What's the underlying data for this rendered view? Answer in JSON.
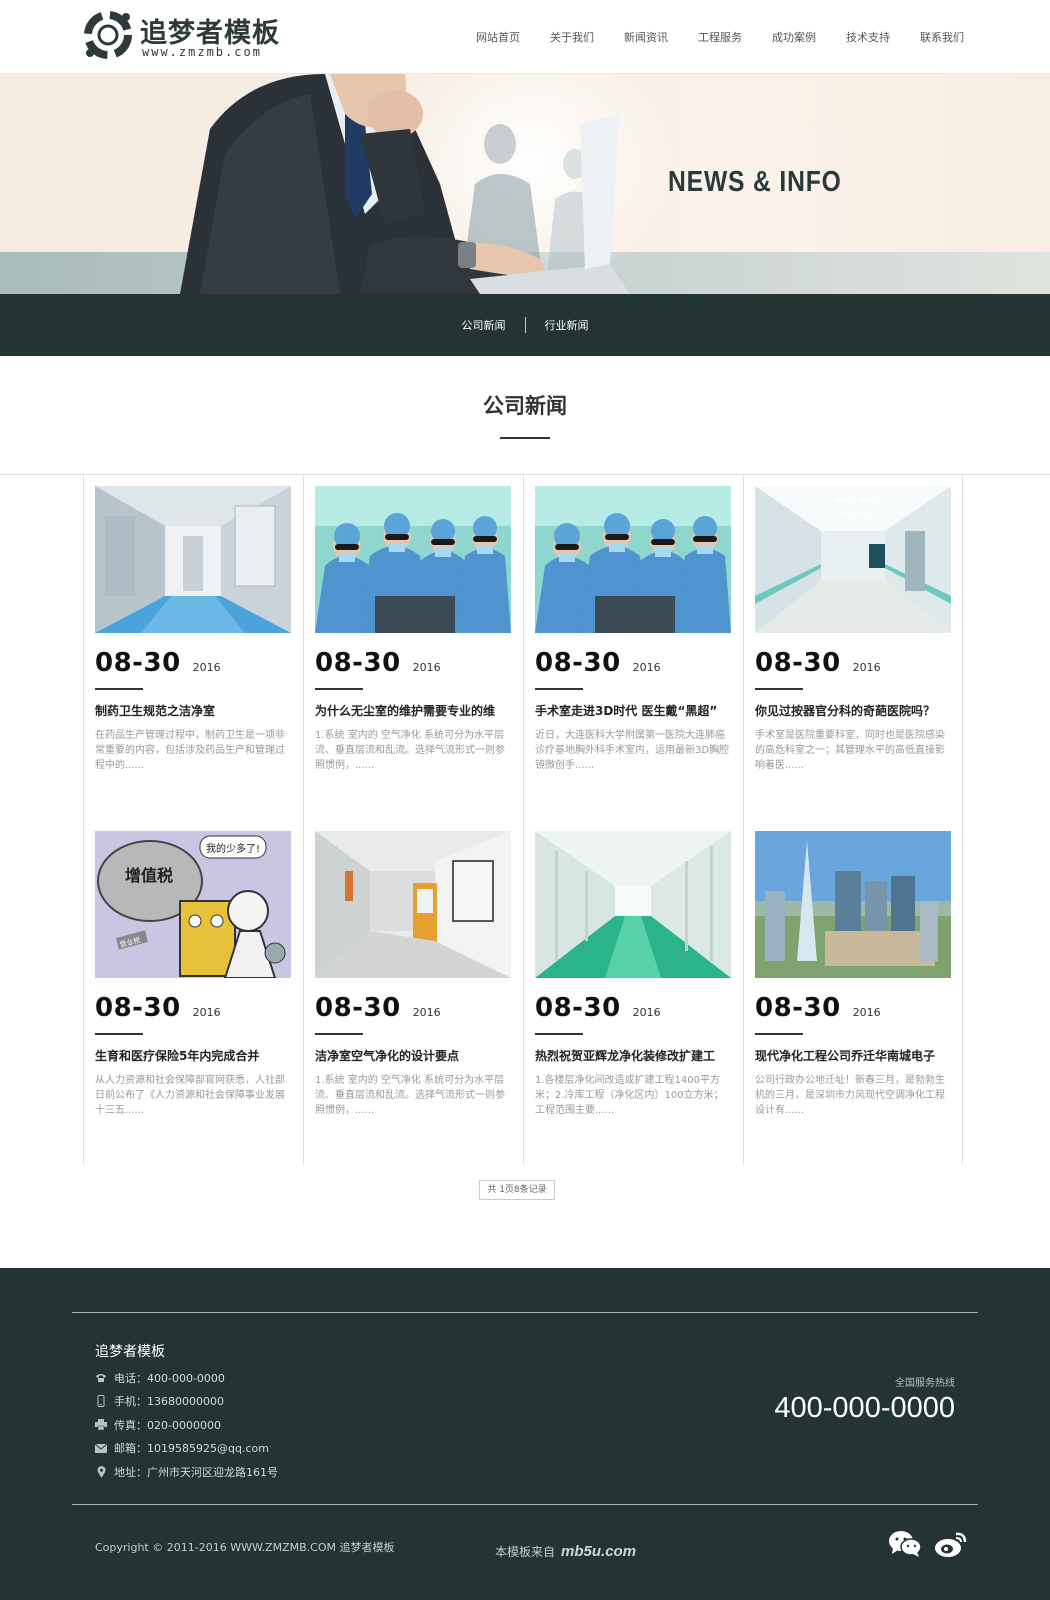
{
  "header": {
    "logo_title": "追梦者模板",
    "logo_sub": "www.zmzmb.com",
    "nav": [
      "网站首页",
      "关于我们",
      "新闻资讯",
      "工程服务",
      "成功案例",
      "技术支持",
      "联系我们"
    ]
  },
  "banner": {
    "text": "NEWS & INFO"
  },
  "subnav": [
    "公司新闻",
    "行业新闻"
  ],
  "section": {
    "title": "公司新闻"
  },
  "news": [
    {
      "day": "08-30",
      "year": "2016",
      "title": "制药卫生规范之洁净室",
      "desc": "在药品生产管理过程中，制药卫生是一项非常重要的内容，包括涉及药品生产和管理过程中的......",
      "image": "cleanroom-corridor"
    },
    {
      "day": "08-30",
      "year": "2016",
      "title": "为什么无尘室的维护需要专业的维",
      "desc": "1.系统 室内的 空气净化 系统可分为水平层流、垂直层流和乱流。选择气流形式一则参照惯例，......",
      "image": "surgeons"
    },
    {
      "day": "08-30",
      "year": "2016",
      "title": "手术室走进3D时代 医生戴“黑超”",
      "desc": "近日，大连医科大学附属第一医院大连肺癌诊疗基地胸外科手术室内，运用最新3D胸腔镜微创手......",
      "image": "surgeons"
    },
    {
      "day": "08-30",
      "year": "2016",
      "title": "你见过按器官分科的奇葩医院吗？",
      "desc": "手术室是医院重要科室，同时也是医院感染的高危科室之一；其管理水平的高低直接影响着医......",
      "image": "hospital-hallway"
    },
    {
      "day": "08-30",
      "year": "2016",
      "title": "生育和医疗保险5年内完成合并",
      "desc": "从人力资源和社会保障部官网获悉，人社部日前公布了《人力资源和社会保障事业发展十三五......",
      "image": "cartoon-tax"
    },
    {
      "day": "08-30",
      "year": "2016",
      "title": "洁净室空气净化的设计要点",
      "desc": "1.系统 室内的 空气净化 系统可分为水平层流、垂直层流和乱流。选择气流形式一则参照惯例，......",
      "image": "lab-corridor"
    },
    {
      "day": "08-30",
      "year": "2016",
      "title": "热烈祝贺亚辉龙净化装修改扩建工",
      "desc": "1.各楼层净化间改造或扩建工程1400平方米；2.冷库工程（净化区内）100立方米；工程范围主要......",
      "image": "green-corridor"
    },
    {
      "day": "08-30",
      "year": "2016",
      "title": "现代净化工程公司乔迁华南城电子",
      "desc": "公司行政办公地迁址！新春三月，是勃勃生机的三月，是深圳市力风现代空调净化工程设计有......",
      "image": "city-towers"
    }
  ],
  "cartoon": {
    "speech": "我的少多了!",
    "tax": "增值税",
    "tag": "营业税"
  },
  "pager": "共 1页8条记录",
  "footer": {
    "company": "追梦者模板",
    "contacts": [
      {
        "icon": "phone-icon",
        "text": "电话：400-000-0000"
      },
      {
        "icon": "mobile-icon",
        "text": "手机：13680000000"
      },
      {
        "icon": "fax-icon",
        "text": "传真：020-0000000"
      },
      {
        "icon": "mail-icon",
        "text": "邮箱：1019585925@qq.com"
      },
      {
        "icon": "location-icon",
        "text": "地址：广州市天河区迎龙路161号"
      }
    ],
    "hotline_label": "全国服务热线",
    "hotline": "400-000-0000",
    "copyright": "Copyright © 2011-2016 WWW.ZMZMB.COM 追梦者模板",
    "source_prefix": "本模板来自",
    "source_brand": "mb5u.com"
  },
  "colors": {
    "dark": "#233433",
    "text": "#333333",
    "muted": "#999999"
  }
}
